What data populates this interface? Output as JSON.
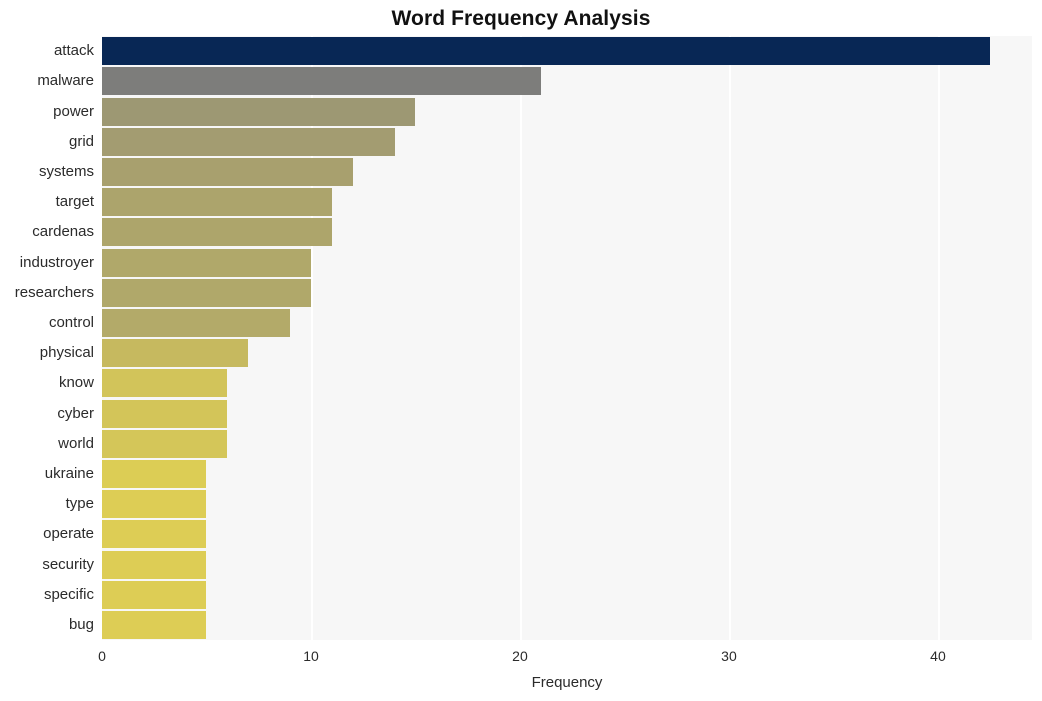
{
  "chart_data": {
    "type": "bar",
    "orientation": "horizontal",
    "title": "Word Frequency Analysis",
    "xlabel": "Frequency",
    "ylabel": "",
    "categories": [
      "attack",
      "malware",
      "power",
      "grid",
      "systems",
      "target",
      "cardenas",
      "industroyer",
      "researchers",
      "control",
      "physical",
      "know",
      "cyber",
      "world",
      "ukraine",
      "type",
      "operate",
      "security",
      "specific",
      "bug"
    ],
    "values": [
      42.5,
      21,
      15,
      14,
      12,
      11,
      11,
      10,
      10,
      9,
      7,
      6,
      6,
      6,
      5,
      5,
      5,
      5,
      5,
      5
    ],
    "bar_colors": [
      "#082755",
      "#7d7d7b",
      "#9d9873",
      "#a39c71",
      "#a8a06e",
      "#aca46c",
      "#ada56b",
      "#b0a86a",
      "#b0a86a",
      "#b3aa69",
      "#c6b95f",
      "#d2c45a",
      "#d3c559",
      "#d4c659",
      "#dccd55",
      "#ddcd55",
      "#ddcd55",
      "#ddcd55",
      "#ddcd55",
      "#ddcd55"
    ],
    "xticks": [
      0,
      10,
      20,
      30,
      40
    ],
    "xlim": [
      0,
      44.5
    ],
    "grid": true,
    "grid_axis": "x",
    "legend": "none",
    "plot_background": "#f7f7f7",
    "figure_background": "#ffffff",
    "gridline_color": "#ffffff"
  }
}
